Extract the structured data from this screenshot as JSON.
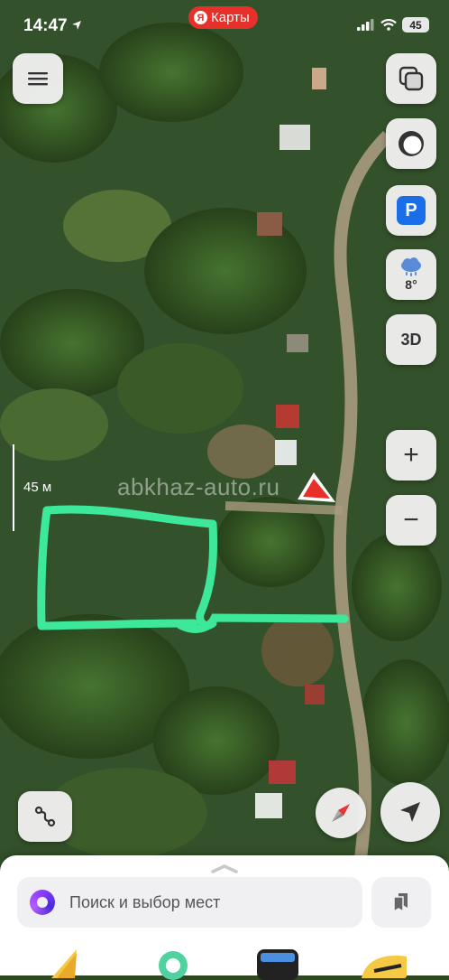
{
  "status_bar": {
    "time": "14:47",
    "app_label": "Карты",
    "app_logo_letter": "Я",
    "battery": "45"
  },
  "map": {
    "scale_label": "45 м",
    "watermark": "abkhaz-auto.ru"
  },
  "controls": {
    "menu_icon": "hamburger-icon",
    "layers_icon": "layers-icon",
    "parking_label": "P",
    "weather_temp": "8°",
    "btn_3d_label": "3D",
    "zoom_in_label": "+",
    "zoom_out_label": "−"
  },
  "bottom_sheet": {
    "search_placeholder": "Поиск и выбор мест"
  },
  "colors": {
    "brand_red": "#e8302a",
    "annotation_green": "#3ee89a",
    "parking_blue": "#1a6fe8"
  }
}
